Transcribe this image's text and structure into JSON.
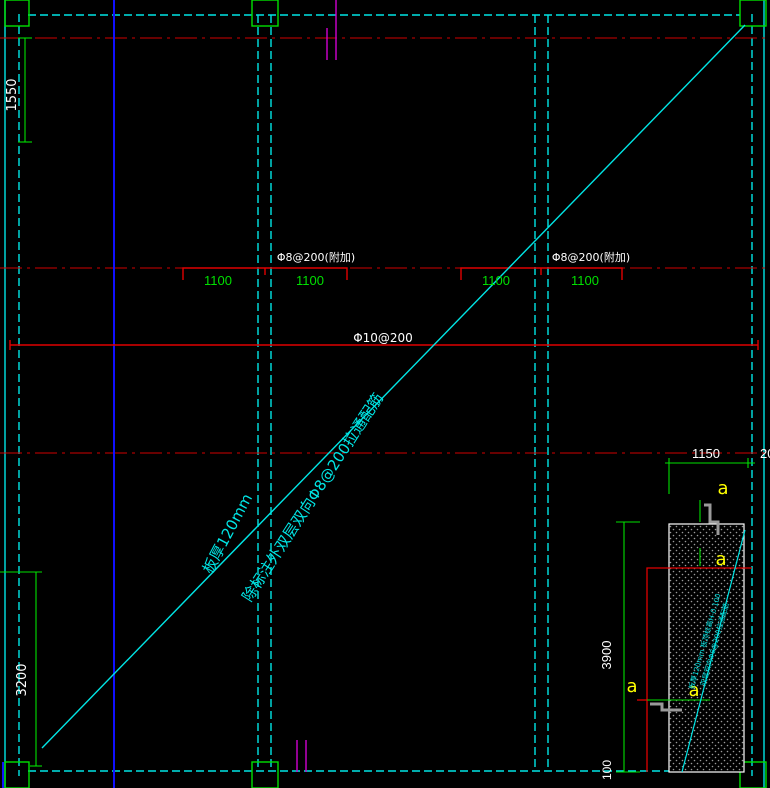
{
  "colors": {
    "background": "#000000",
    "cyan": "#00e5e5",
    "red": "#e00000",
    "green": "#00e000",
    "white": "#ffffff",
    "blue": "#1010ff",
    "magenta": "#d000d0",
    "yellow": "#ffff00",
    "grey": "#9a9a9a"
  },
  "labels": {
    "dim_top_left": "1550",
    "dim_bottom_left": "3200",
    "bar_spec_add_1": "Φ8@200(附加)",
    "bar_spec_add_2": "Φ8@200(附加)",
    "seg_1": "1100",
    "seg_2": "1100",
    "seg_3": "1100",
    "seg_4": "1100",
    "bar_spec_main": "Φ10@200",
    "diag_note_line1": "板厚120mm",
    "diag_note_line2": "除标注外双层双向Φ8@200拉通配筋",
    "dim_right_top": "1150",
    "dim_right_top_partial": "20",
    "dim_right_vertical": "3900",
    "dim_right_bottom": "100",
    "sym_a_1": "a",
    "sym_a_2": "a",
    "sym_a_3": "a",
    "sym_a_4": "a",
    "detail_note_line1": "板厚120mm 板顶标高H-0.100",
    "detail_note_line2": "双层双向Φ8@200拉通配筋"
  }
}
